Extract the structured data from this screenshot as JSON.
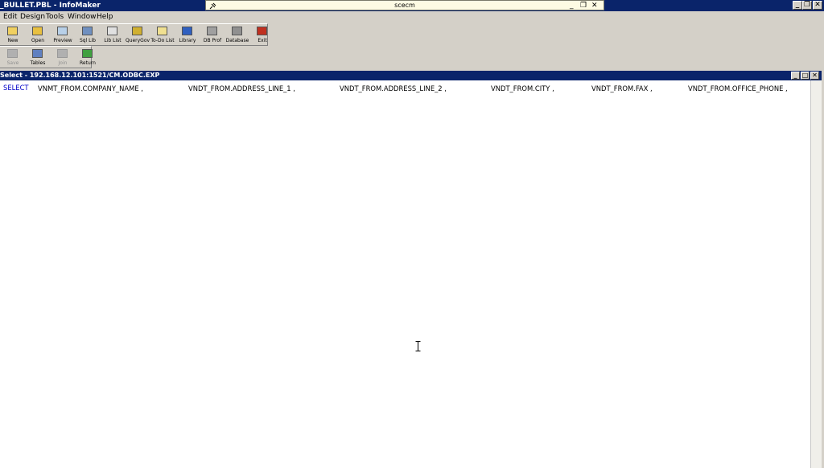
{
  "window": {
    "title": "_BULLET.PBL - InfoMaker",
    "buttons": {
      "minimize": "_",
      "restore": "❐",
      "close": "✕"
    }
  },
  "remote": {
    "title": "scecm",
    "buttons": {
      "minimize": "_",
      "restore": "❐",
      "close": "✕"
    }
  },
  "menu": [
    "Edit",
    "Design",
    "Tools",
    "Window",
    "Help"
  ],
  "toolbar1": [
    {
      "label": "New",
      "icon": "new-icon",
      "color": "#f0d060"
    },
    {
      "label": "Open",
      "icon": "open-folder-icon",
      "color": "#e8c040"
    },
    {
      "label": "Preview",
      "icon": "preview-icon",
      "color": "#b8d0e8"
    },
    {
      "label": "Sql Lib",
      "icon": "sql-lib-icon",
      "color": "#7090c0"
    },
    {
      "label": "Lib List",
      "icon": "lib-list-icon",
      "color": "#e0e0e0"
    },
    {
      "label": "QueryGov",
      "icon": "query-gov-icon",
      "color": "#d0b030"
    },
    {
      "label": "To-Do List",
      "icon": "todo-list-icon",
      "color": "#f0e090"
    },
    {
      "label": "Library",
      "icon": "library-icon",
      "color": "#3060c0"
    },
    {
      "label": "DB Prof",
      "icon": "db-profile-icon",
      "color": "#a0a0a0"
    },
    {
      "label": "Database",
      "icon": "database-icon",
      "color": "#909090"
    },
    {
      "label": "Exit",
      "icon": "exit-icon",
      "color": "#c03020"
    }
  ],
  "toolbar2": [
    {
      "label": "Save",
      "icon": "save-icon",
      "disabled": true,
      "color": "#b0b0b0"
    },
    {
      "label": "Tables",
      "icon": "tables-icon",
      "disabled": false,
      "color": "#6080c0"
    },
    {
      "label": "Join",
      "icon": "join-icon",
      "disabled": true,
      "color": "#b0b0b0"
    },
    {
      "label": "Return",
      "icon": "return-icon",
      "disabled": false,
      "color": "#40a040"
    }
  ],
  "child": {
    "title": "Select - 192.168.12.101:1521/CM.ODBC.EXP",
    "buttons": {
      "minimize": "_",
      "restore": "□",
      "close": "✕"
    }
  },
  "sql": {
    "keyword": "SELECT",
    "columns": [
      "VNMT_FROM.COMPANY_NAME ,",
      "VNDT_FROM.ADDRESS_LINE_1 ,",
      "VNDT_FROM.ADDRESS_LINE_2 ,",
      "VNDT_FROM.CITY ,",
      "VNDT_FROM.FAX ,",
      "VNDT_FROM.OFFICE_PHONE ,"
    ]
  }
}
